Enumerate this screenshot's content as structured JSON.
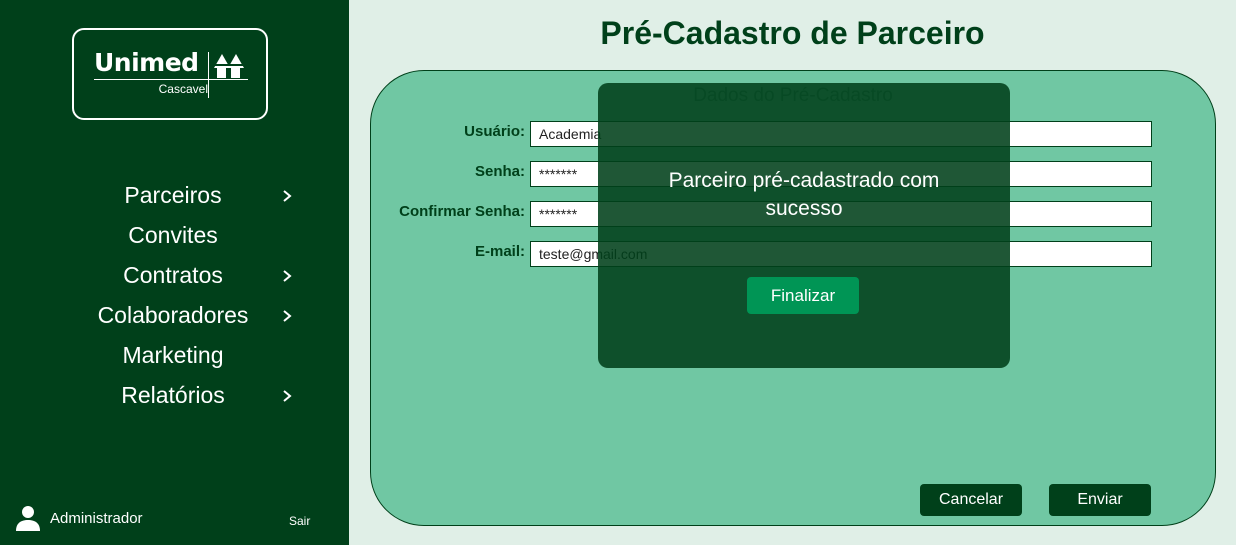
{
  "logo": {
    "name": "Unimed",
    "subtitle": "Cascavel"
  },
  "sidebar": {
    "items": [
      {
        "label": "Parceiros",
        "has_submenu": true
      },
      {
        "label": "Convites",
        "has_submenu": false
      },
      {
        "label": "Contratos",
        "has_submenu": true
      },
      {
        "label": "Colaboradores",
        "has_submenu": true
      },
      {
        "label": "Marketing",
        "has_submenu": false
      },
      {
        "label": "Relatórios",
        "has_submenu": true
      }
    ],
    "user": {
      "name": "Administrador",
      "icon": "user-icon"
    },
    "logout_label": "Sair"
  },
  "page": {
    "title": "Pré-Cadastro de Parceiro"
  },
  "form": {
    "section_title": "Dados do Pré-Cadastro",
    "fields": [
      {
        "label": "Usuário:",
        "value": "Academia"
      },
      {
        "label": "Senha:",
        "value": "*******"
      },
      {
        "label": "Confirmar Senha:",
        "value": "*******"
      },
      {
        "label": "E-mail:",
        "value": "teste@gmail.com"
      }
    ],
    "cancel_label": "Cancelar",
    "submit_label": "Enviar"
  },
  "modal": {
    "message": "Parceiro pré-cadastrado com sucesso",
    "button_label": "Finalizar"
  },
  "colors": {
    "sidebar_bg": "#00401a",
    "page_bg": "#e0efe7",
    "card_bg": "#70c7a3",
    "modal_bg": "#00401a",
    "modal_button": "#009555"
  }
}
